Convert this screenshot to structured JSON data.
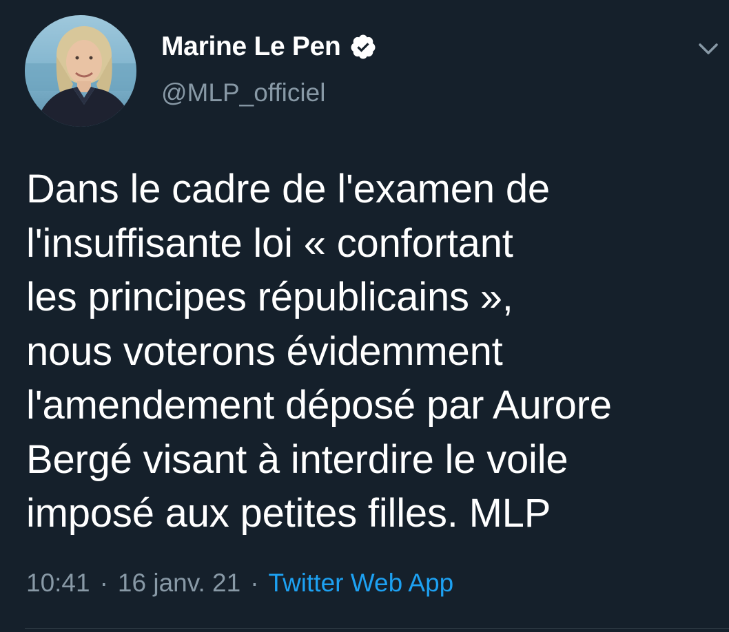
{
  "tweet": {
    "author": {
      "display_name": "Marine Le Pen",
      "handle": "@MLP_officiel",
      "verified": true,
      "avatar_icon": "profile-photo"
    },
    "text": "Dans le cadre de l'examen de\nl'insuffisante loi « confortant\nles principes républicains »,\nnous voterons évidemment\nl'amendement déposé par Aurore\nBergé visant à interdire le voile\nimposé aux petites filles. MLP",
    "time": "10:41",
    "separator": "·",
    "date": "16 janv. 21",
    "source": "Twitter Web App",
    "menu_icon": "chevron-down-icon"
  },
  "colors": {
    "background": "#15202b",
    "primary_text": "#ffffff",
    "secondary_text": "#8899a6",
    "accent": "#1da1f2",
    "divider": "#38444d"
  }
}
